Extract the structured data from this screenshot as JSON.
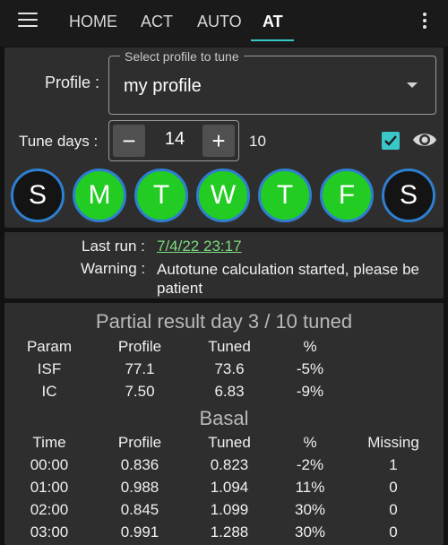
{
  "tabs": [
    {
      "label": "HOME",
      "active": false
    },
    {
      "label": "ACT",
      "active": false
    },
    {
      "label": "AUTO",
      "active": false
    },
    {
      "label": "AT",
      "active": true
    }
  ],
  "colors": {
    "accent": "#3ac7c7",
    "day_on": "#22cc22",
    "day_ring": "#2e7fd0",
    "link": "#7fdc7f"
  },
  "profile": {
    "label": "Profile :",
    "legend": "Select profile to tune",
    "value": "my profile"
  },
  "tune_days": {
    "label": "Tune days :",
    "minus": "−",
    "plus": "+",
    "value": "14",
    "calculated": "10",
    "checkbox_checked": true
  },
  "days": [
    {
      "letter": "S",
      "selected": false
    },
    {
      "letter": "M",
      "selected": true
    },
    {
      "letter": "T",
      "selected": true
    },
    {
      "letter": "W",
      "selected": true
    },
    {
      "letter": "T",
      "selected": true
    },
    {
      "letter": "F",
      "selected": true
    },
    {
      "letter": "S",
      "selected": false
    }
  ],
  "status": {
    "last_run_label": "Last run :",
    "last_run_value": "7/4/22 23:17",
    "warning_label": "Warning :",
    "warning_value": "Autotune calculation started, please be patient"
  },
  "result": {
    "title": "Partial result day 3 / 10 tuned",
    "param_headers": [
      "Param",
      "Profile",
      "Tuned",
      "%"
    ],
    "param_rows": [
      [
        "ISF",
        "77.1",
        "73.6",
        "-5%"
      ],
      [
        "IC",
        "7.50",
        "6.83",
        "-9%"
      ]
    ],
    "basal_title": "Basal",
    "basal_headers": [
      "Time",
      "Profile",
      "Tuned",
      "%",
      "Missing"
    ],
    "basal_rows": [
      [
        "00:00",
        "0.836",
        "0.823",
        "-2%",
        "1"
      ],
      [
        "01:00",
        "0.988",
        "1.094",
        "11%",
        "0"
      ],
      [
        "02:00",
        "0.845",
        "1.099",
        "30%",
        "0"
      ],
      [
        "03:00",
        "0.991",
        "1.288",
        "30%",
        "0"
      ]
    ]
  }
}
